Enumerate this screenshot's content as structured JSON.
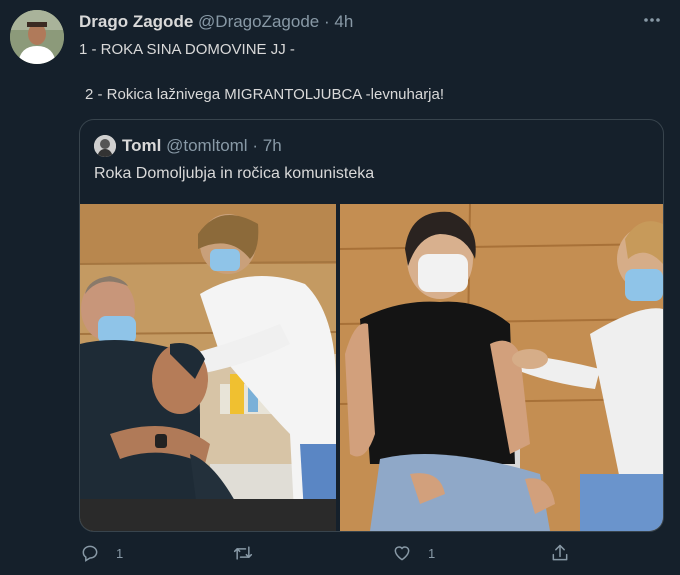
{
  "tweet": {
    "author_name": "Drago Zagode",
    "author_handle": "@DragoZagode",
    "separator": "·",
    "time": "4h",
    "more_icon": "more-horizontal-icon",
    "line1": "1 - ROKA SINA DOMOVINE JJ -",
    "line2": "2 - Rokica lažnivega MIGRANTOLJUBCA -levnuharja!"
  },
  "quote": {
    "author_name": "Toml",
    "author_handle": "@tomltoml",
    "separator": "·",
    "time": "7h",
    "text": "Roka Domoljubja in ročica komunisteka"
  },
  "actions": {
    "reply_count": "1",
    "retweet_count": "",
    "like_count": "1",
    "icons": [
      "reply-icon",
      "retweet-icon",
      "like-icon",
      "share-icon"
    ]
  },
  "colors": {
    "background": "#15202b",
    "text": "#d9d9d9",
    "secondary": "#8899a6",
    "border": "#38444d"
  }
}
